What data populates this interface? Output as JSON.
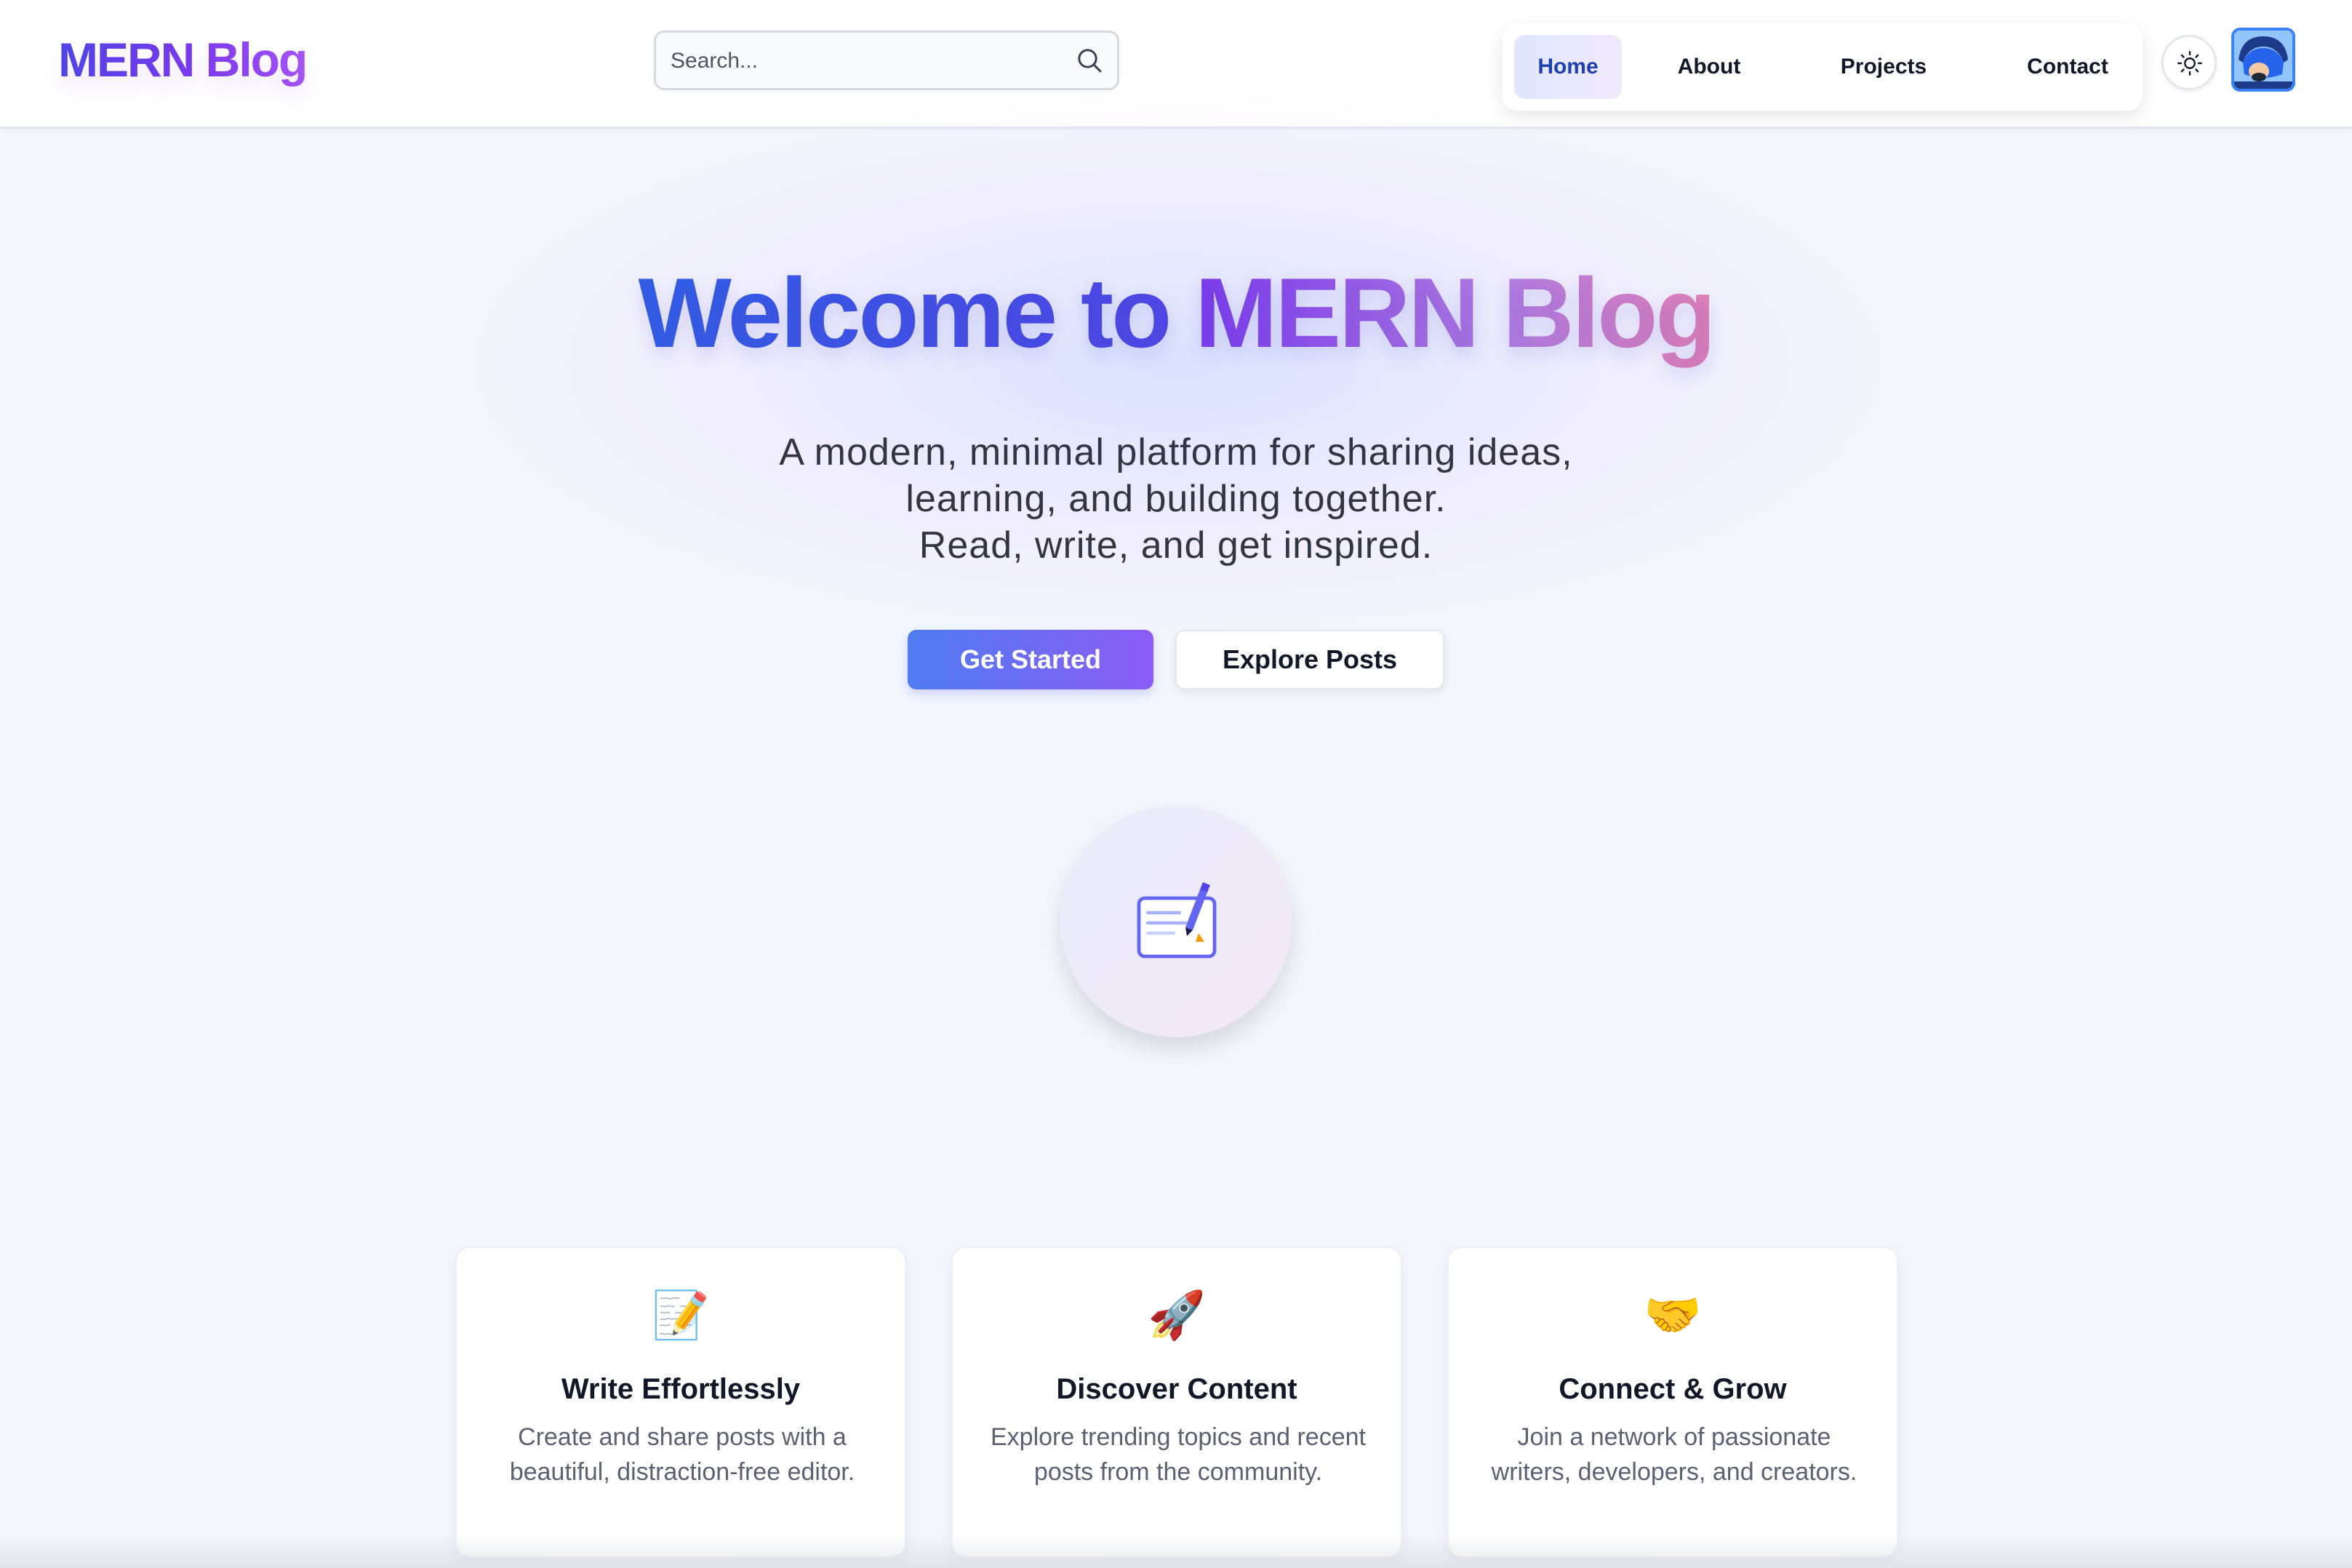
{
  "header": {
    "logo": "MERN Blog",
    "search_placeholder": "Search...",
    "nav": [
      "Home",
      "About",
      "Projects",
      "Contact"
    ],
    "active_nav": "Home"
  },
  "hero": {
    "title_part1": "Welcome to",
    "title_part2": "MERN Blog",
    "subtitle_lines": [
      "A modern, minimal platform for sharing ideas,",
      "learning, and building together.",
      "Read, write, and get inspired."
    ],
    "primary_button": "Get Started",
    "secondary_button": "Explore Posts",
    "illustration": "write-post-icon"
  },
  "features": [
    {
      "icon": "📝",
      "icon_name": "memo-icon",
      "title": "Write Effortlessly",
      "description": "Create and share posts with a beautiful, distraction-free editor."
    },
    {
      "icon": "🚀",
      "icon_name": "rocket-icon",
      "title": "Discover Content",
      "description": "Explore trending topics and recent posts from the community."
    },
    {
      "icon": "🤝",
      "icon_name": "handshake-icon",
      "title": "Connect & Grow",
      "description": "Join a network of passionate writers, developers, and creators."
    }
  ],
  "colors": {
    "brand_gradient_start": "#4f46e5",
    "brand_gradient_end": "#a855f7",
    "primary_button_start": "#4f7cf0",
    "primary_button_end": "#8b5cf6",
    "active_nav_text": "#1e40af",
    "page_background": "#f3f6fd"
  }
}
